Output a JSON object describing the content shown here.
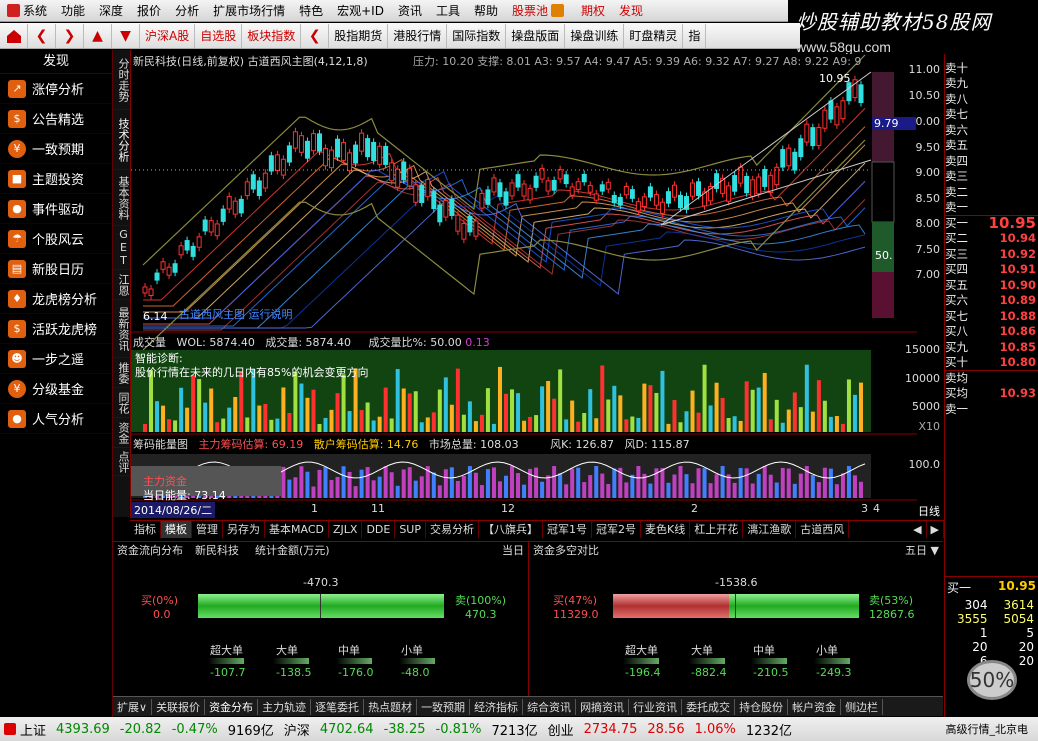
{
  "menu": {
    "items": [
      "系统",
      "功能",
      "深度",
      "报价",
      "分析",
      "扩展市场行情",
      "特色",
      "宏观+ID",
      "资讯",
      "工具",
      "帮助",
      "股票池",
      "期权",
      "发现"
    ],
    "icons": {
      "sys": "#d02020",
      "pool": "#e08000"
    }
  },
  "brand": {
    "title": "炒股辅助教材58股网",
    "url": "www.58gu.com"
  },
  "toolbar": {
    "items": [
      "沪深A股",
      "自选股",
      "板块指数",
      "股指期货",
      "港股行情",
      "国际指数",
      "操盘版面",
      "操盘训练",
      "盯盘精灵",
      "指"
    ]
  },
  "sidebar": {
    "title": "发现",
    "items": [
      {
        "label": "涨停分析",
        "icon": "chart-icon"
      },
      {
        "label": "公告精选",
        "icon": "dollar-icon"
      },
      {
        "label": "一致预期",
        "icon": "coin-icon"
      },
      {
        "label": "主题投资",
        "icon": "briefcase-icon"
      },
      {
        "label": "事件驱动",
        "icon": "person-icon"
      },
      {
        "label": "个股风云",
        "icon": "umbrella-icon"
      },
      {
        "label": "新股日历",
        "icon": "bars-icon"
      },
      {
        "label": "龙虎榜分析",
        "icon": "bag-icon"
      },
      {
        "label": "活跃龙虎榜",
        "icon": "dollar-icon"
      },
      {
        "label": "一步之遥",
        "icon": "people-icon"
      },
      {
        "label": "分级基金",
        "icon": "coin-icon"
      },
      {
        "label": "人气分析",
        "icon": "person-icon"
      }
    ]
  },
  "vtabs": [
    "分时走势",
    "技术分析",
    "基本资料",
    "GET",
    "江恩",
    "最新资讯",
    "推委",
    "同花",
    "资金",
    "点评"
  ],
  "chart": {
    "title": "新民科技(日线,前复权) 古道西风主图(4,12,1,8)",
    "pressure": "压力: 10.20  支撑: 8.01  A3: 9.57  A4: 9.47  A5: 9.39  A6: 9.32  A7: 9.27  A8: 9.22  A9: 9",
    "high_label": "10.95",
    "low_label": "6.14",
    "watermark": "古道西风主图 运行说明",
    "price_axis": [
      "11.00",
      "10.50",
      "10.00",
      "9.50",
      "9.00",
      "8.50",
      "8.00",
      "7.50",
      "7.00"
    ],
    "current": "9.79",
    "side_label": "50."
  },
  "volume": {
    "title": "成交量",
    "wol": "WOL: 5874.40",
    "vol": "成交量: 5874.40",
    "ratio": "成交量比%: 50.00",
    "extra": "0.13",
    "diag1": "智能诊断:",
    "diag2": "股价行情在未来的几日内有85%的机会变更方向",
    "axis": [
      "15000",
      "10000",
      "5000"
    ],
    "unit": "X10"
  },
  "chip": {
    "title": "筹码能量图",
    "main": "主力筹码估算: 69.19",
    "retail": "散户筹码估算: 14.76",
    "total": "市场总量: 108.03",
    "fk": "风K: 126.87",
    "fd": "风D: 115.87",
    "axis": "100.0",
    "label1": "主力资金",
    "label2": "当日能量: 73.14"
  },
  "date_axis": {
    "date": "2014/08/26/二",
    "ticks": [
      "1",
      "11",
      "12",
      "2",
      "3",
      "4"
    ],
    "period": "日线"
  },
  "tabs": [
    "指标",
    "模板",
    "管理",
    "另存为",
    "基本MACD",
    "ZJLX",
    "DDE",
    "SUP",
    "交易分析",
    "【八旗兵】",
    "冠军1号",
    "冠军2号",
    "麦色K线",
    "杠上开花",
    "漓江渔歌",
    "古道西风"
  ],
  "flow": {
    "header": [
      "资金流向分布",
      "新民科技",
      "统计金额(万元)",
      "当日",
      "资金多空对比",
      "五日"
    ],
    "left": {
      "net": "-470.3",
      "buy_label": "买(0%)",
      "buy": "0.0",
      "sell_label": "卖(100%)",
      "sell": "470.3"
    },
    "right": {
      "net": "-1538.6",
      "buy_label": "买(47%)",
      "buy": "11329.0",
      "sell_label": "卖(53%)",
      "sell": "12867.6"
    },
    "cats": [
      "超大单",
      "大单",
      "中单",
      "小单"
    ],
    "left_vals": [
      "-107.7",
      "-138.5",
      "-176.0",
      "-48.0"
    ],
    "right_vals": [
      "-196.4",
      "-882.4",
      "-210.5",
      "-249.3"
    ]
  },
  "orderbook": {
    "sells": [
      "卖十",
      "卖九",
      "卖八",
      "卖七",
      "卖六",
      "卖五",
      "卖四",
      "卖三",
      "卖二",
      "卖一"
    ],
    "buys": [
      [
        "买一",
        "10.95"
      ],
      [
        "买二",
        "10.94"
      ],
      [
        "买三",
        "10.92"
      ],
      [
        "买四",
        "10.91"
      ],
      [
        "买五",
        "10.90"
      ],
      [
        "买六",
        "10.89"
      ],
      [
        "买七",
        "10.88"
      ],
      [
        "买八",
        "10.86"
      ],
      [
        "买九",
        "10.85"
      ],
      [
        "买十",
        "10.80"
      ]
    ],
    "avg_sell": "卖均",
    "avg_buy": "买均",
    "avg_buy_price": "10.93",
    "sell_one": "卖一",
    "detail": {
      "buy1": "买一",
      "buy1_price": "10.95",
      "rows": [
        [
          "304",
          "3614"
        ],
        [
          "3555",
          "5054"
        ],
        [
          "1",
          "5"
        ],
        [
          "20",
          "20"
        ],
        [
          "6",
          "20"
        ]
      ]
    }
  },
  "bottom": [
    "扩展∨",
    "关联报价",
    "资金分布",
    "主力轨迹",
    "逐笔委托",
    "热点题材",
    "一致预期",
    "经济指标",
    "综合资讯",
    "网摘资讯",
    "行业资讯",
    "委托成交",
    "持仓股份",
    "帐户资金",
    "侧边栏"
  ],
  "status": {
    "sh_name": "上证",
    "sh": "4393.69",
    "sh_chg": "-20.82",
    "sh_pct": "-0.47%",
    "sh_amt": "9169亿",
    "hs_name": "沪深",
    "hs": "4702.64",
    "hs_chg": "-38.25",
    "hs_pct": "-0.81%",
    "hs_amt": "7213亿",
    "cy_name": "创业",
    "cy": "2734.75",
    "cy_chg": "28.56",
    "cy_pct": "1.06%",
    "cy_amt": "1232亿",
    "right": "高级行情_北京电"
  },
  "percent": "50%"
}
